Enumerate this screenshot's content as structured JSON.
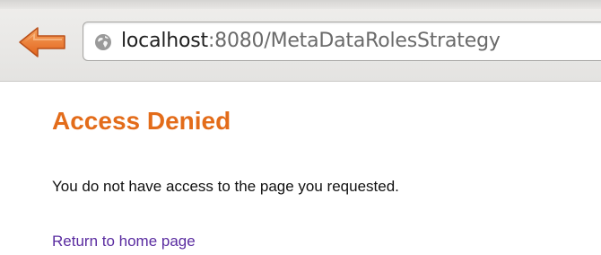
{
  "browser": {
    "back_icon": "back-arrow-icon",
    "url_icon": "globe-icon",
    "url": {
      "host": "localhost",
      "rest": ":8080/MetaDataRolesStrategy"
    }
  },
  "page": {
    "title": "Access Denied",
    "message": "You do not have access to the page you requested.",
    "home_link": "Return to home page"
  },
  "colors": {
    "title": "#e36c1a",
    "link": "#5a2ca0",
    "back_arrow": "#ec7a2c",
    "toolbar": "#e9e8e6"
  }
}
